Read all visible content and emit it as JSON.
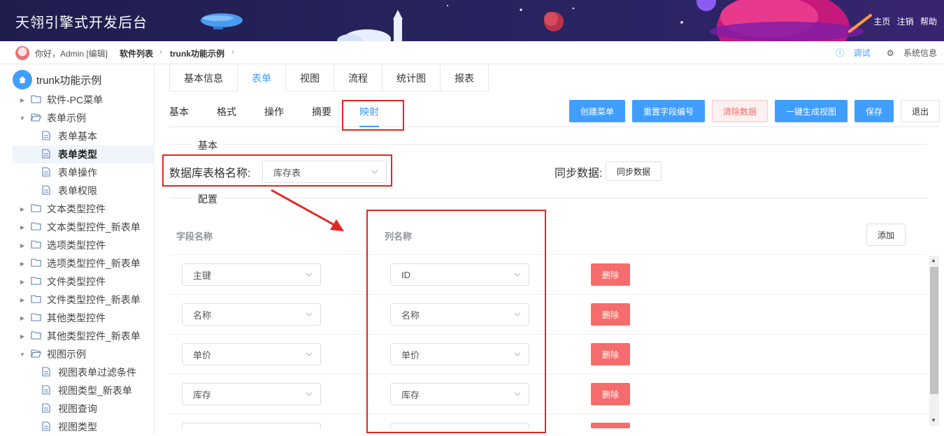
{
  "header": {
    "title": "天翎引擎式开发后台",
    "links": [
      "主页",
      "注销",
      "帮助"
    ]
  },
  "breadcrumb": {
    "greeting": "你好，Admin [编辑]",
    "items": [
      "软件列表",
      "trunk功能示例"
    ],
    "tools": [
      "调试",
      "系统信息"
    ]
  },
  "sidebar": {
    "root": "trunk功能示例",
    "items": [
      {
        "label": "软件-PC菜单"
      },
      {
        "label": "表单示例"
      },
      {
        "label": "表单基本"
      },
      {
        "label": "表单类型"
      },
      {
        "label": "表单操作"
      },
      {
        "label": "表单权限"
      },
      {
        "label": "文本类型控件"
      },
      {
        "label": "文本类型控件_新表单"
      },
      {
        "label": "选项类型控件"
      },
      {
        "label": "选项类型控件_新表单"
      },
      {
        "label": "文件类型控件"
      },
      {
        "label": "文件类型控件_新表单"
      },
      {
        "label": "其他类型控件"
      },
      {
        "label": "其他类型控件_新表单"
      },
      {
        "label": "视图示例"
      },
      {
        "label": "视图表单过滤条件"
      },
      {
        "label": "视图类型_新表单"
      },
      {
        "label": "视图查询"
      },
      {
        "label": "视图类型"
      }
    ]
  },
  "tabs": [
    "基本信息",
    "表单",
    "视图",
    "流程",
    "统计图",
    "报表"
  ],
  "subtabs": [
    "基本",
    "格式",
    "操作",
    "摘要",
    "映射"
  ],
  "toolbar": {
    "create_menu": "创建菜单",
    "reset_field": "重置字段编号",
    "clear_data": "清除数据",
    "gen_view": "一键生成视图",
    "save": "保存",
    "exit": "退出"
  },
  "basic": {
    "section": "基本",
    "db_label": "数据库表格名称:",
    "db_value": "库存表",
    "sync_label": "同步数据:",
    "sync_button": "同步数据"
  },
  "config": {
    "section": "配置",
    "col_field": "字段名称",
    "col_column": "列名称",
    "add_button": "添加",
    "delete_label": "删除",
    "rows": [
      {
        "field": "主键",
        "column": "ID"
      },
      {
        "field": "名称",
        "column": "名称"
      },
      {
        "field": "单价",
        "column": "单价"
      },
      {
        "field": "库存",
        "column": "库存"
      }
    ]
  },
  "colors": {
    "primary": "#409eff",
    "danger": "#f56c6c",
    "annotation": "#e52424",
    "header_bg": "#27235c"
  }
}
